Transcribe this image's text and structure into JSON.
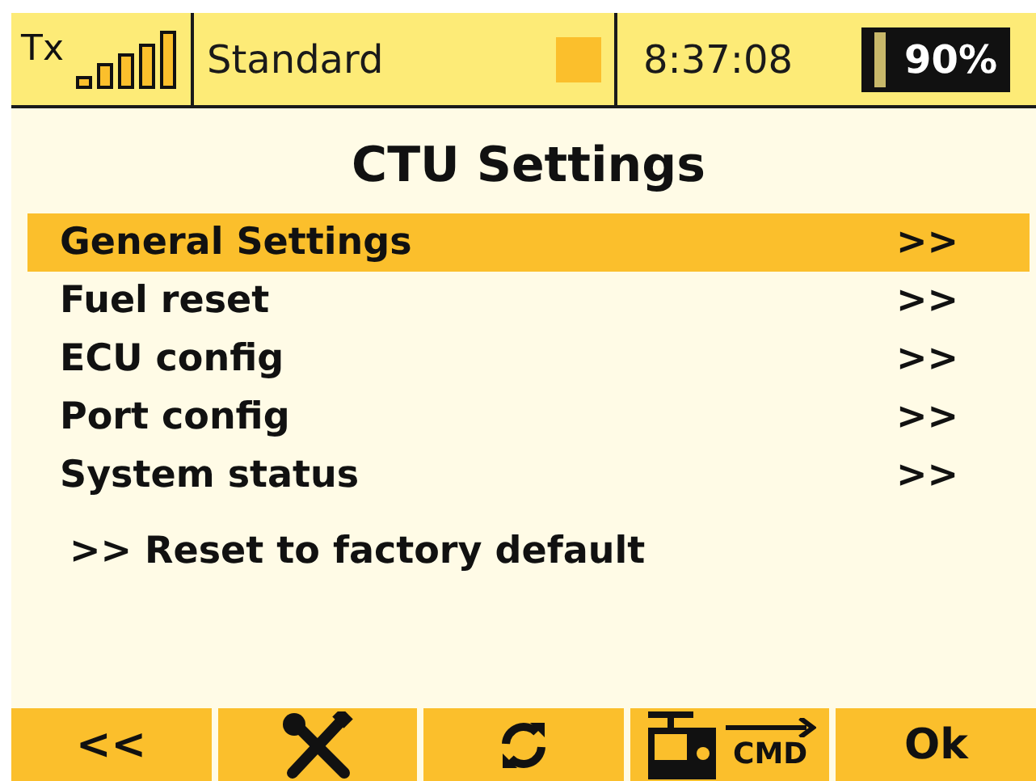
{
  "status_bar": {
    "tx_label": "Tx",
    "profile": "Standard",
    "time": "8:37:08",
    "battery": "90%"
  },
  "title": "CTU Settings",
  "menu": [
    {
      "label": "General Settings",
      "arrow": ">>",
      "selected": true
    },
    {
      "label": "Fuel reset",
      "arrow": ">>",
      "selected": false
    },
    {
      "label": "ECU config",
      "arrow": ">>",
      "selected": false
    },
    {
      "label": "Port config",
      "arrow": ">>",
      "selected": false
    },
    {
      "label": "System status",
      "arrow": ">>",
      "selected": false
    }
  ],
  "action": ">> Reset to factory default",
  "buttons": [
    {
      "kind": "text",
      "label": "<<"
    },
    {
      "kind": "tools"
    },
    {
      "kind": "refresh"
    },
    {
      "kind": "command",
      "label": "CMD"
    },
    {
      "kind": "text",
      "label": "Ok"
    }
  ]
}
